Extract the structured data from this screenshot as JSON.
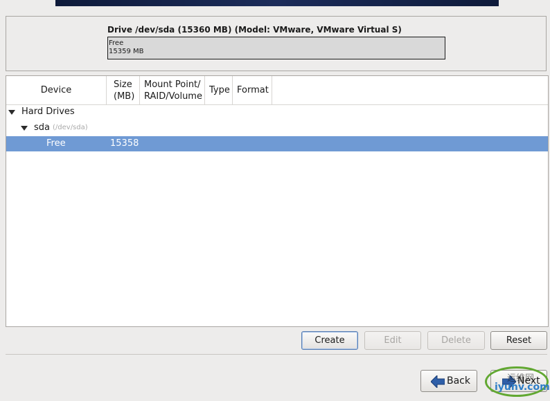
{
  "drive": {
    "title": "Drive /dev/sda (15360 MB) (Model: VMware, VMware Virtual S)",
    "segment_label": "Free",
    "segment_size": "15359 MB"
  },
  "table": {
    "columns": [
      "Device",
      "Size\n(MB)",
      "Mount Point/\nRAID/Volume",
      "Type",
      "Format"
    ],
    "rows": {
      "hard_drives": "Hard Drives",
      "sda_name": "sda",
      "sda_path": "(/dev/sda)",
      "free_label": "Free",
      "free_size": "15358"
    }
  },
  "buttons": {
    "create": "Create",
    "edit": "Edit",
    "delete": "Delete",
    "reset": "Reset",
    "back": "Back",
    "next": "Next"
  },
  "watermark": {
    "text": "iyunv.com",
    "cn": "运维网"
  },
  "colors": {
    "selection": "#6f9ad4",
    "arrow": "#2f5fa8",
    "watermark_ring": "#62a832"
  }
}
